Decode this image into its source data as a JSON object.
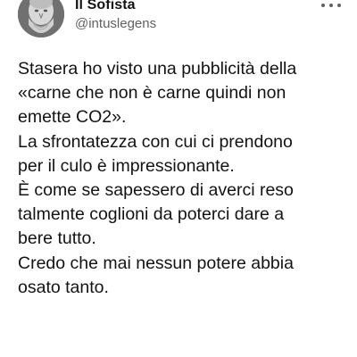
{
  "author": {
    "display_name": "Il Sofista",
    "handle": "@intuslegens"
  },
  "tweet": {
    "lines": [
      "Stasera ho visto una pubblicità della",
      "«carne che non è carne quindi non",
      "emette CO2».",
      "La sfrontatezza con cui ci prendono",
      "per il culo è impressionante.",
      "È come se sapessero di averci reso",
      "talmente coglioni da poterci dare a",
      "bere tutto.",
      "Credo che mai nessun potere abbia",
      "osato tanto."
    ]
  },
  "icons": {
    "avatar": "bust-portrait-avatar",
    "menu": "more-options-icon"
  }
}
